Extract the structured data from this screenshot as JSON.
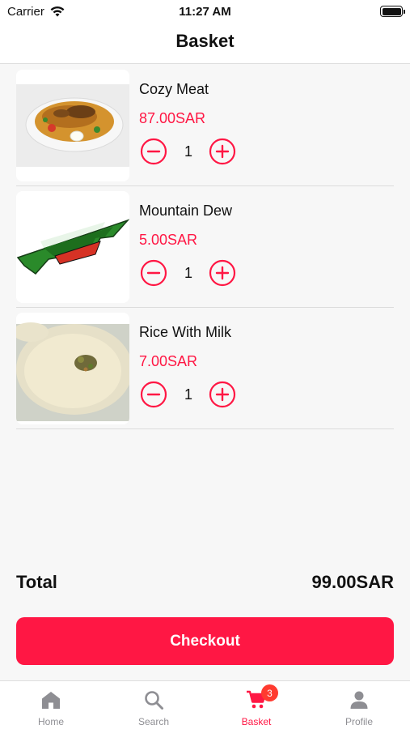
{
  "status_bar": {
    "carrier": "Carrier",
    "time": "11:27 AM"
  },
  "header": {
    "title": "Basket"
  },
  "colors": {
    "accent": "#ff1744",
    "badge": "#ff3b30",
    "inactive_tab": "#8e8e93"
  },
  "items": [
    {
      "name": "Cozy Meat",
      "price": "87.00SAR",
      "quantity": "1",
      "image": "biryani-plate-photo"
    },
    {
      "name": "Mountain Dew",
      "price": "5.00SAR",
      "quantity": "1",
      "image": "mountain-dew-logo"
    },
    {
      "name": "Rice With Milk",
      "price": "7.00SAR",
      "quantity": "1",
      "image": "rice-pudding-bowl-photo"
    }
  ],
  "summary": {
    "total_label": "Total",
    "total_value": "99.00SAR",
    "checkout_label": "Checkout"
  },
  "tabs": [
    {
      "label": "Home",
      "icon": "home-icon",
      "active": false
    },
    {
      "label": "Search",
      "icon": "search-icon",
      "active": false
    },
    {
      "label": "Basket",
      "icon": "cart-icon",
      "active": true,
      "badge": "3"
    },
    {
      "label": "Profile",
      "icon": "person-icon",
      "active": false
    }
  ]
}
